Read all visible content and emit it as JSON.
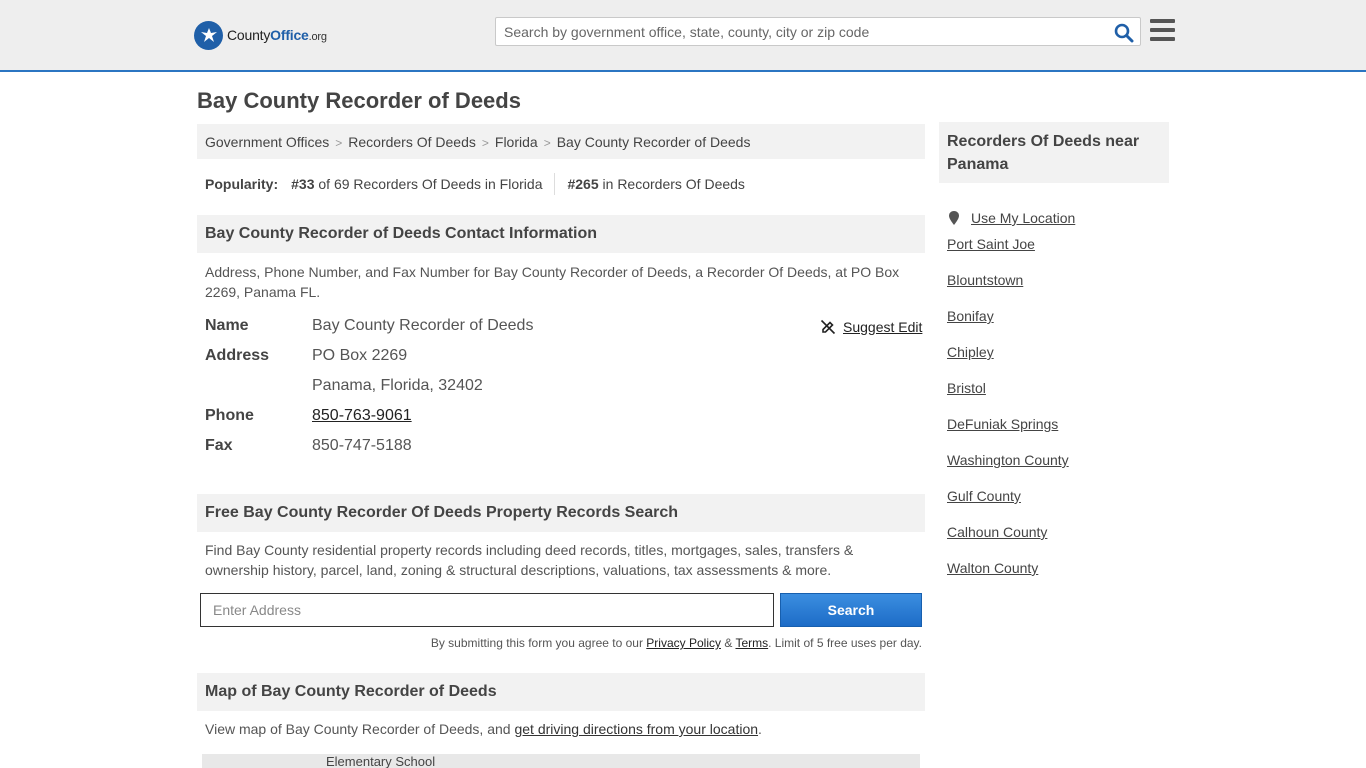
{
  "header": {
    "logo_text_prefix": "County",
    "logo_text_strong": "Office",
    "logo_text_suffix": ".org",
    "search_placeholder": "Search by government office, state, county, city or zip code"
  },
  "page_title": "Bay County Recorder of Deeds",
  "breadcrumb": [
    "Government Offices",
    "Recorders Of Deeds",
    "Florida",
    "Bay County Recorder of Deeds"
  ],
  "popularity": {
    "label": "Popularity:",
    "state_rank": "#33",
    "state_text": "of 69 Recorders Of Deeds in Florida",
    "national_rank": "#265",
    "national_text": "in Recorders Of Deeds"
  },
  "contact": {
    "heading": "Bay County Recorder of Deeds Contact Information",
    "description": "Address, Phone Number, and Fax Number for Bay County Recorder of Deeds, a Recorder Of Deeds, at PO Box 2269, Panama FL.",
    "suggest_edit": "Suggest Edit",
    "name_label": "Name",
    "name_value": "Bay County Recorder of Deeds",
    "address_label": "Address",
    "address_line1": "PO Box 2269",
    "address_line2": "Panama, Florida, 32402",
    "phone_label": "Phone",
    "phone_value": "850-763-9061",
    "fax_label": "Fax",
    "fax_value": "850-747-5188"
  },
  "property_search": {
    "heading": "Free Bay County Recorder Of Deeds Property Records Search",
    "description": "Find Bay County residential property records including deed records, titles, mortgages, sales, transfers & ownership history, parcel, land, zoning & structural descriptions, valuations, tax assessments & more.",
    "input_placeholder": "Enter Address",
    "button_label": "Search",
    "disclaimer_prefix": "By submitting this form you agree to our",
    "privacy_link": "Privacy Policy",
    "amp": "&",
    "terms_link": "Terms",
    "disclaimer_suffix": ". Limit of 5 free uses per day."
  },
  "map": {
    "heading": "Map of Bay County Recorder of Deeds",
    "description_prefix": "View map of Bay County Recorder of Deeds, and",
    "directions_link": "get driving directions from your location",
    "description_suffix": ".",
    "map_label": "Elementary School"
  },
  "sidebar": {
    "heading": "Recorders Of Deeds near Panama",
    "use_location": "Use My Location",
    "items": [
      "Port Saint Joe",
      "Blountstown",
      "Bonifay",
      "Chipley",
      "Bristol",
      "DeFuniak Springs",
      "Washington County",
      "Gulf County",
      "Calhoun County",
      "Walton County"
    ]
  },
  "colors": {
    "accent": "#2b75c2",
    "button": "#1d6cc7",
    "panel": "#f2f2f2",
    "header_bg": "#eeeeee"
  }
}
